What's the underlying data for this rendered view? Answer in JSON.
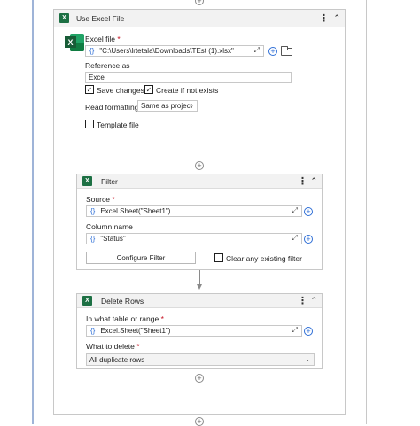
{
  "use_excel_file": {
    "title": "Use Excel File",
    "excel_file_label": "Excel file",
    "required_mark": "*",
    "excel_file_value": "\"C:\\Users\\lrtetala\\Downloads\\TEst (1).xlsx\"",
    "reference_as_label": "Reference as",
    "reference_as_value": "Excel",
    "save_changes_label": "Save changes",
    "save_changes_checked": true,
    "create_if_not_exists_label": "Create if not exists",
    "create_if_not_exists_checked": true,
    "read_formatting_label": "Read formatting",
    "read_formatting_value": "Same as project",
    "template_file_label": "Template file",
    "template_file_checked": false
  },
  "filter": {
    "title": "Filter",
    "source_label": "Source",
    "required_mark": "*",
    "source_value": "Excel.Sheet(\"Sheet1\")",
    "column_name_label": "Column name",
    "column_name_value": "\"Status\"",
    "configure_button": "Configure Filter",
    "clear_filter_label": "Clear any existing filter",
    "clear_filter_checked": false
  },
  "delete_rows": {
    "title": "Delete Rows",
    "range_label": "In what table or range",
    "required_mark": "*",
    "range_value": "Excel.Sheet(\"Sheet1\")",
    "what_to_delete_label": "What to delete",
    "what_to_delete_value": "All duplicate rows"
  },
  "glyphs": {
    "brace": "{}",
    "expand": "⤢",
    "plus": "+",
    "dots": "⋮",
    "collapse": "⌃",
    "chevron": "⌄",
    "check": "✓",
    "excel_letter": "X"
  },
  "colors": {
    "excel_green": "#1d7044",
    "accent_blue": "#2f6fd6",
    "required_red": "#c50f1f",
    "timeline_line": "#9fb4d8"
  }
}
